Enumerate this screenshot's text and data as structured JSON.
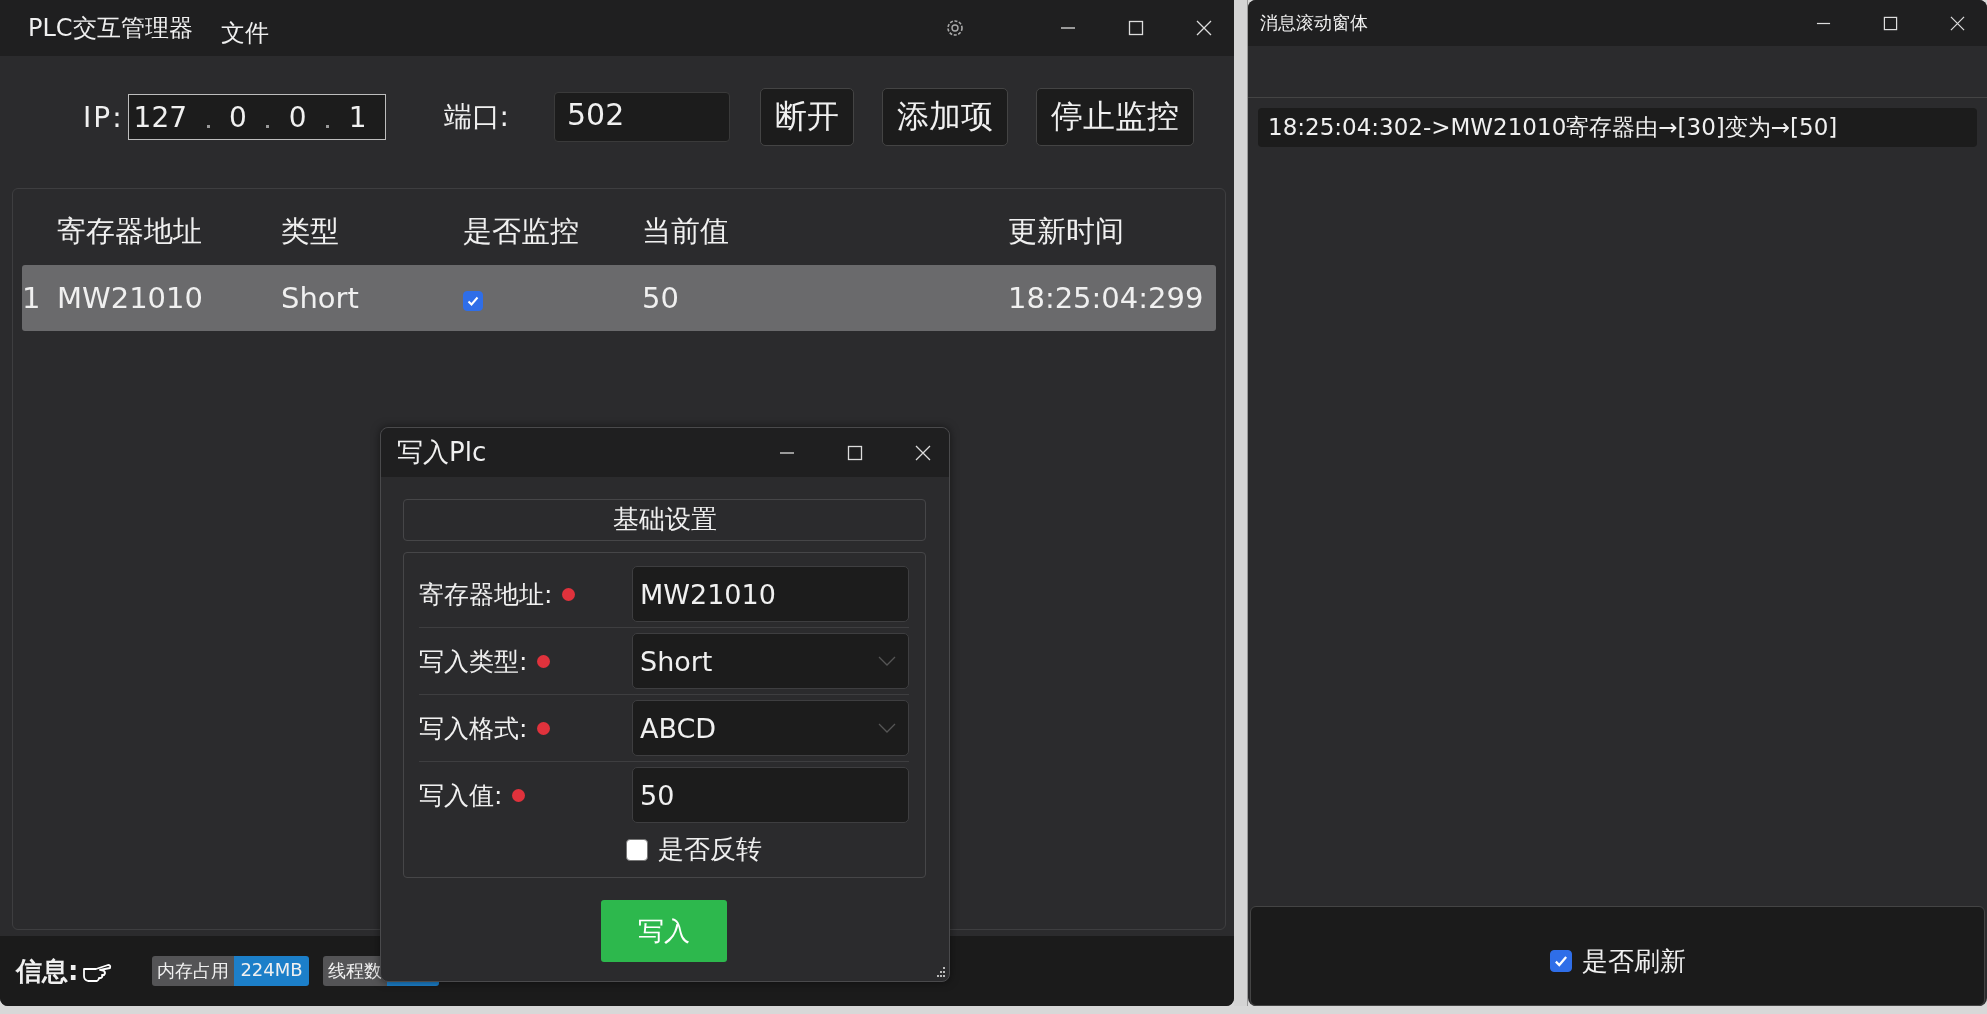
{
  "main_window": {
    "title": "PLC交互管理器",
    "menu": [
      "文件"
    ]
  },
  "connection": {
    "ip_label": "IP:",
    "ip": [
      "127",
      "0",
      "0",
      "1"
    ],
    "port_label": "端口:",
    "port": "502"
  },
  "toolbar_buttons": [
    "断开",
    "添加项",
    "停止监控"
  ],
  "table": {
    "columns": [
      "寄存器地址",
      "类型",
      "是否监控",
      "当前值",
      "更新时间"
    ],
    "rows": [
      {
        "index": "1",
        "address": "MW21010",
        "type": "Short",
        "monitored": true,
        "value": "50",
        "updated": "18:25:04:299",
        "selected": true
      }
    ]
  },
  "status_bar": {
    "label": "信息:",
    "badges": [
      {
        "name": "内存占用",
        "value": "224MB"
      },
      {
        "name": "线程数"
      }
    ]
  },
  "dialog": {
    "title": "写入Plc",
    "group": "基础设置",
    "fields": [
      {
        "kind": "input",
        "label": "寄存器地址:",
        "required": true,
        "value": "MW21010"
      },
      {
        "kind": "select",
        "label": "写入类型:",
        "required": true,
        "value": "Short"
      },
      {
        "kind": "select",
        "label": "写入格式:",
        "required": true,
        "value": "ABCD"
      },
      {
        "kind": "input",
        "label": "写入值:",
        "required": true,
        "value": "50"
      }
    ],
    "reverse": {
      "label": "是否反转",
      "checked": false
    },
    "submit": "写入"
  },
  "message_window": {
    "title": "消息滚动窗体",
    "messages": [
      "18:25:04:302->MW21010寄存器由→[30]变为→[50]"
    ],
    "refresh": {
      "label": "是否刷新",
      "checked": true
    }
  }
}
